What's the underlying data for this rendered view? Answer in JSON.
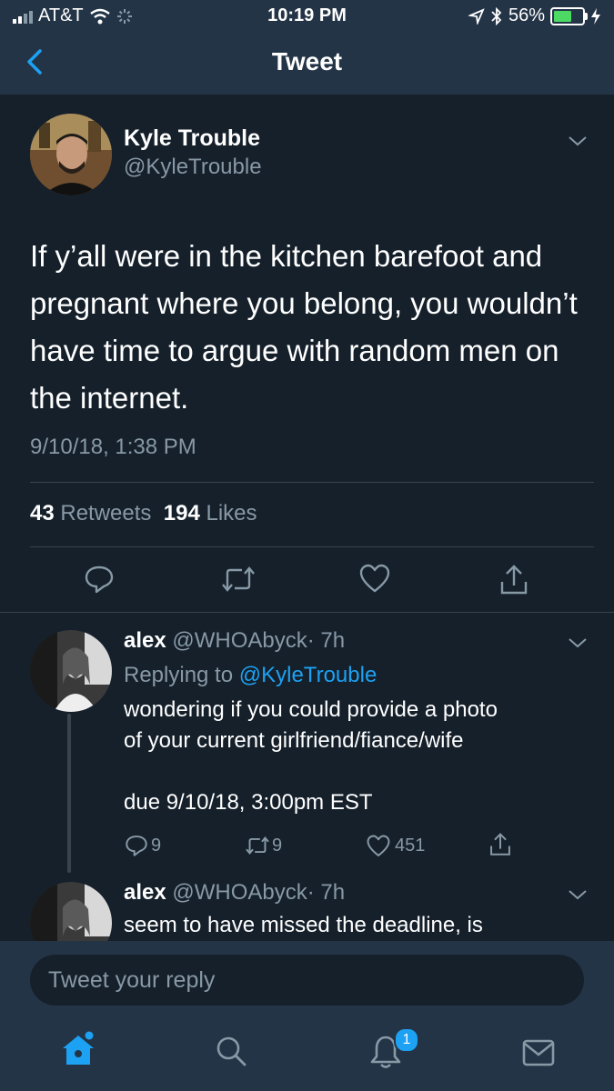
{
  "status_bar": {
    "carrier": "AT&T",
    "time": "10:19 PM",
    "battery": "56%",
    "battery_level": 0.56
  },
  "nav": {
    "title": "Tweet"
  },
  "tweet": {
    "author_name": "Kyle Trouble",
    "author_handle": "@KyleTrouble",
    "text": "If y’all were in the kitchen barefoot and pregnant where you belong, you wouldn’t have time to argue with random men on the internet.",
    "date": "9/10/18, 1:38 PM",
    "retweets_count": "43",
    "retweets_label": "Retweets",
    "likes_count": "194",
    "likes_label": "Likes"
  },
  "replies": [
    {
      "name": "alex",
      "handle": "@WHOAbyck",
      "time": "· 7h",
      "replying_label": "Replying to",
      "replying_to": "@KyleTrouble",
      "text": "wondering if you could provide a photo\nof your current girlfriend/fiance/wife\n\ndue 9/10/18, 3:00pm EST",
      "replies_count": "9",
      "retweets_count": "9",
      "likes_count": "451"
    },
    {
      "name": "alex",
      "handle": "@WHOAbyck",
      "time": "· 7h",
      "text": "seem to have missed the deadline, is"
    }
  ],
  "composer": {
    "placeholder": "Tweet your reply"
  },
  "tab_bar": {
    "notifications_badge": "1"
  },
  "colors": {
    "background": "#15202b",
    "bar": "#243447",
    "accent": "#1da1f2",
    "muted": "#8899a6"
  }
}
